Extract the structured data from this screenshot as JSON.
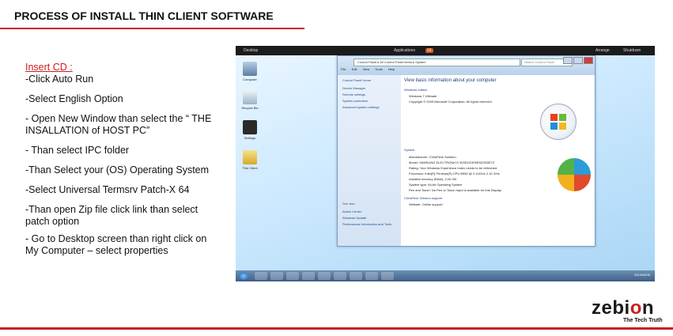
{
  "title": "PROCESS OF INSTALL THIN CLIENT SOFTWARE",
  "instructions": {
    "heading": "Insert CD :",
    "line_auto_run": "-Click Auto Run",
    "line_english": "-Select English Option",
    "line_new_window_1": "- Open New Window than select the “ THE",
    "line_new_window_2": "INSALLATION of HOST PC”",
    "line_ipc": "- Than select IPC folder",
    "line_os": "-Than Select your (OS) Operating System",
    "line_patch": "-Select Universal Termsrv Patch-X 64",
    "line_zip_1": "-Than open Zip file click link than select",
    "line_zip_2": "patch option",
    "line_desktop_1": "- Go to Desktop screen than right click on",
    "line_desktop_2": "My Computer – select properties"
  },
  "screenshot": {
    "topbar": {
      "desktop_label": "Desktop",
      "toolbar_label": "Applications",
      "badge": "16",
      "arrange": "Arrange",
      "shutdown": "Shutdown"
    },
    "desktop_icons": [
      "Computer",
      "Recycle Bin",
      "Settings",
      "Thin Client"
    ],
    "window": {
      "address": "Control Panel ▸ All Control Panel Items ▸ System",
      "search_placeholder": "Search Control Panel",
      "menu": [
        "File",
        "Edit",
        "View",
        "Tools",
        "Help"
      ],
      "sidebar": [
        "Control Panel Home",
        "Device Manager",
        "Remote settings",
        "System protection",
        "Advanced system settings",
        "See also",
        "Action Center",
        "Windows Update",
        "Performance Information and Tools"
      ],
      "heading": "View basic information about your computer",
      "edition_label": "Windows edition",
      "edition": "Windows 7 Ultimate",
      "copyright": "Copyright © 2009 Microsoft Corporation. All rights reserved.",
      "system_label": "System",
      "system_rows": [
        "Manufacturer: ChrisPeck Solution",
        "Model: SAMSUNG ELECTRONICS 300E4Z/300E5Z/300E7Z",
        "Rating: Your Windows Experience Index needs to be refreshed",
        "Processor: Intel(R) Pentium(R) CPU B950 @ 2.10GHz 2.10 GHz",
        "Installed memory (RAM): 2.00 GB",
        "System type: 64-bit Operating System",
        "Pen and Touch: No Pen or Touch Input is available for this Display"
      ],
      "support_label": "ChrisPeck Solution support",
      "website": "Website: Online support"
    },
    "clock": "2013/05/06"
  },
  "brand": {
    "name_a": "zebi",
    "name_o": "o",
    "name_b": "n",
    "tagline": "The Tech Truth"
  },
  "colors": {
    "accent_red": "#cc1f1f"
  }
}
